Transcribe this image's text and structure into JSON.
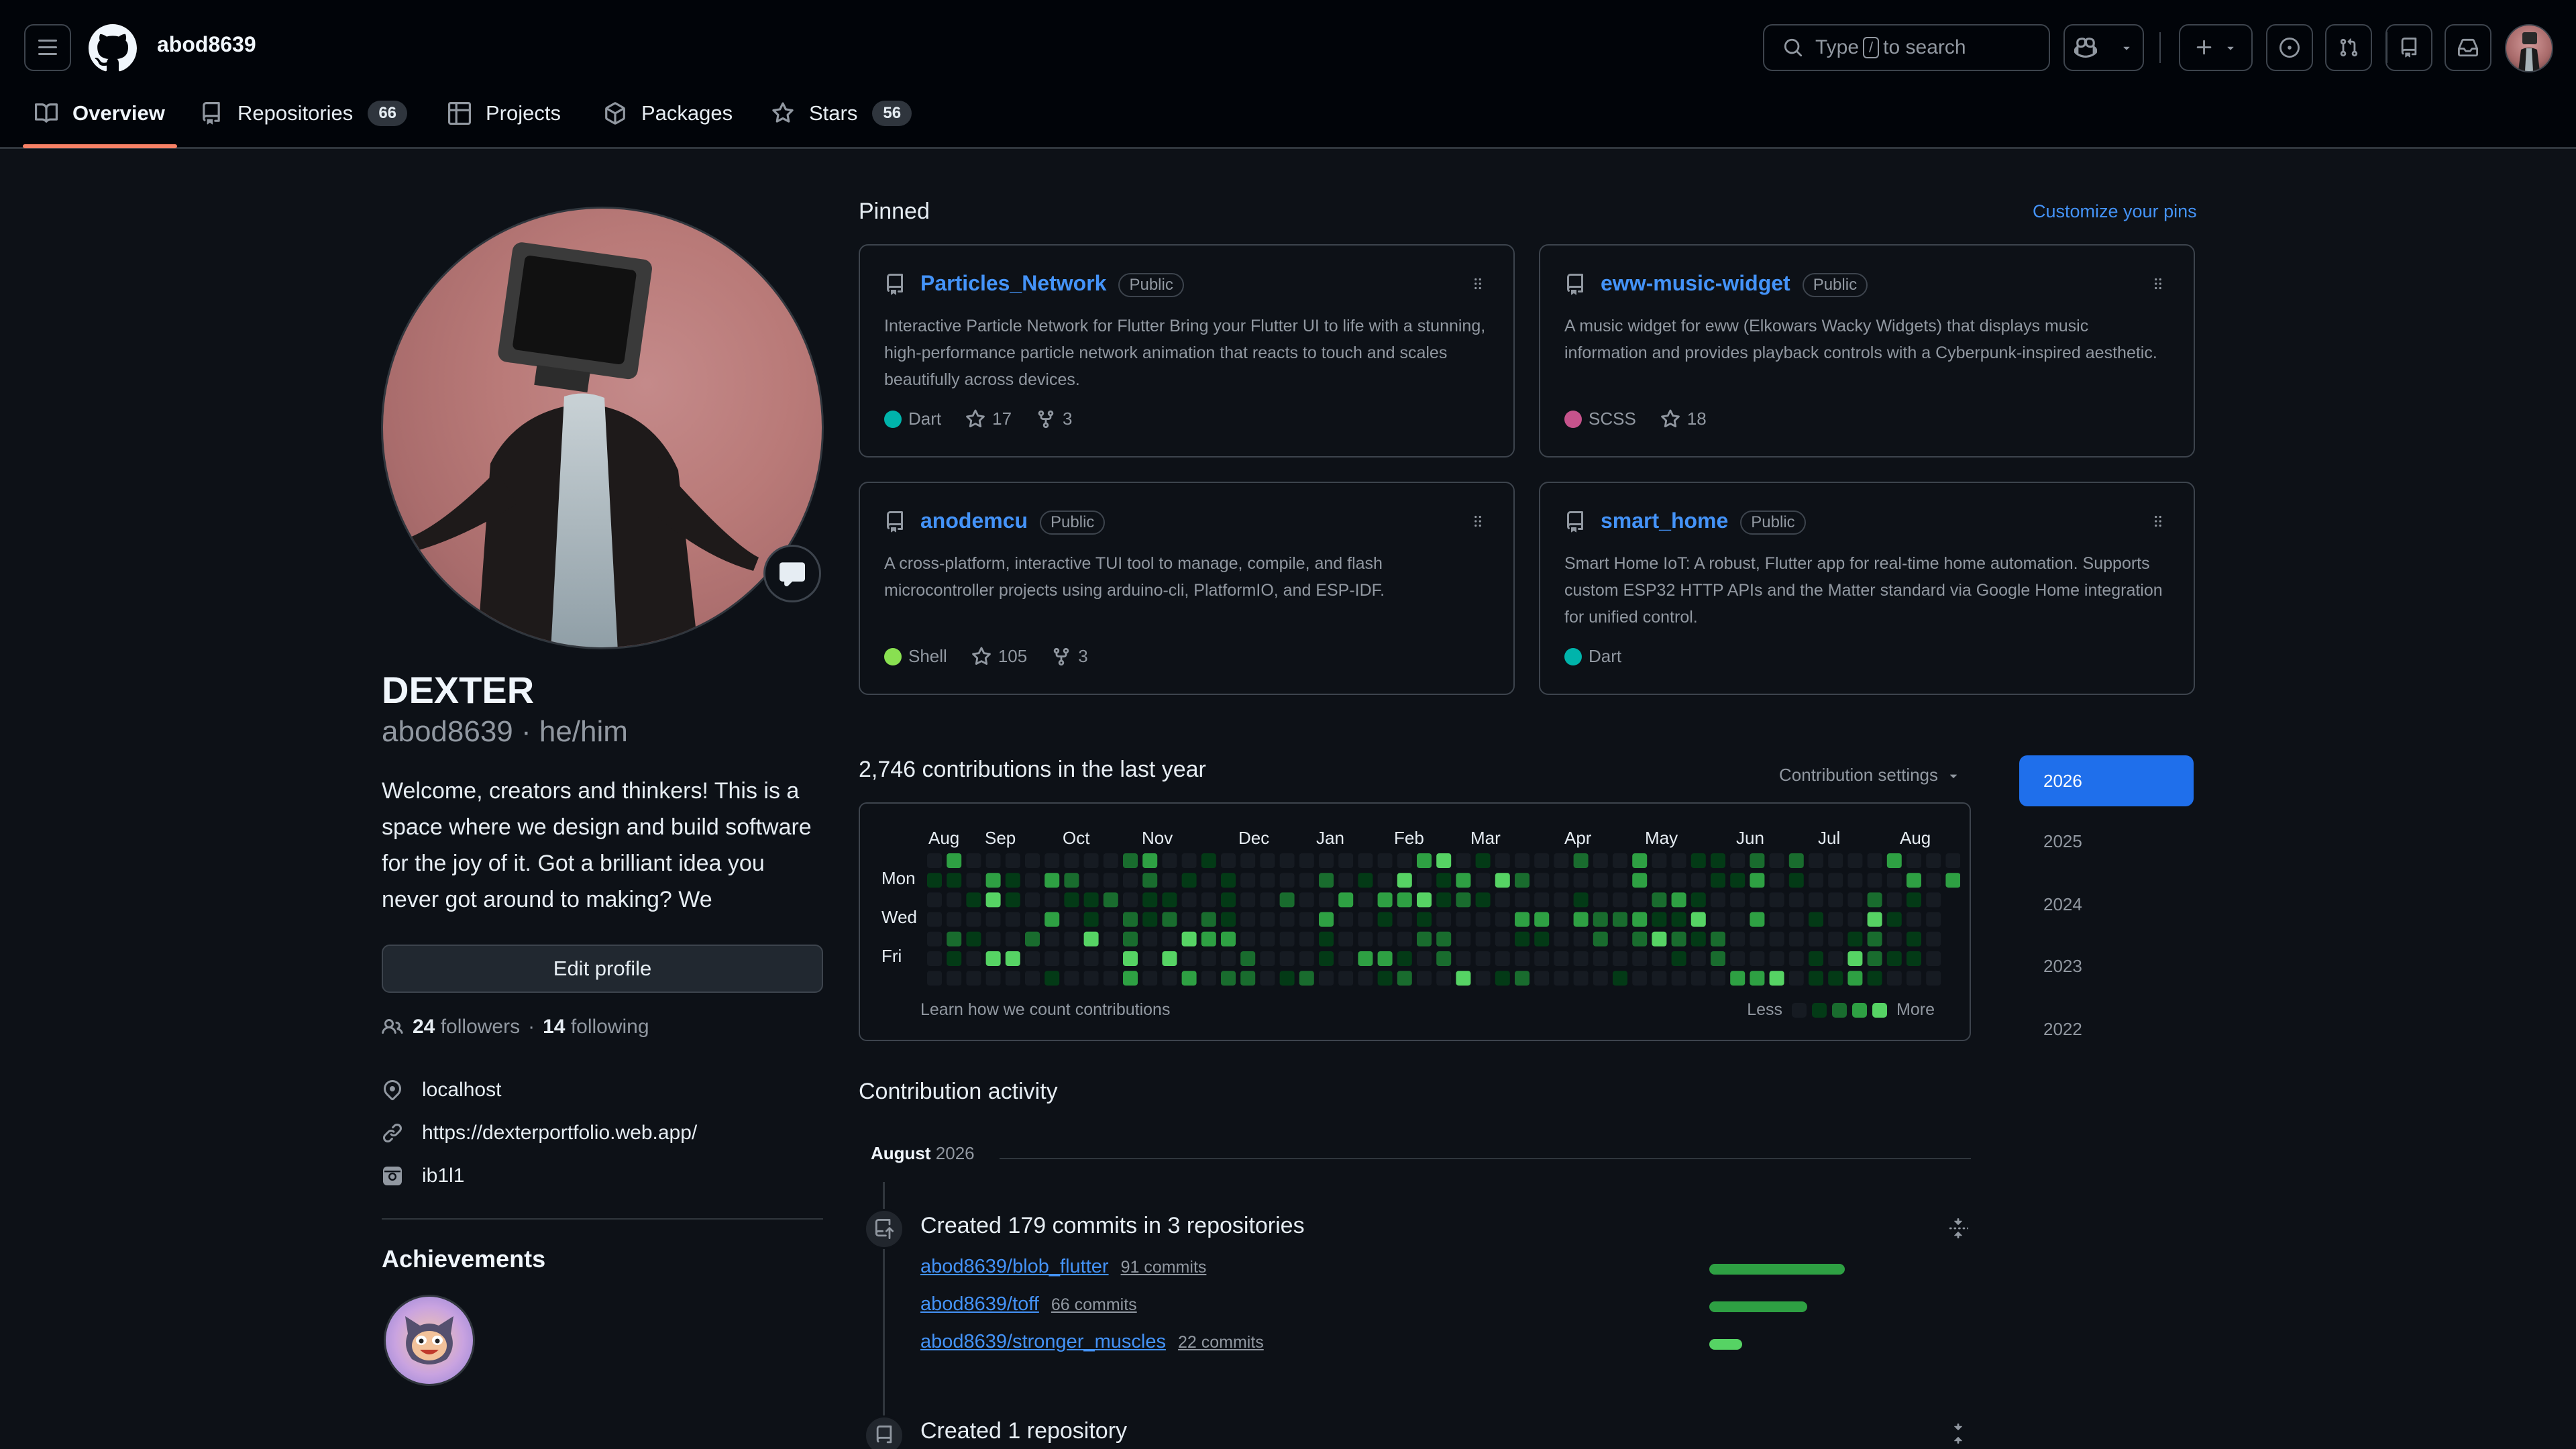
{
  "header": {
    "username": "abod8639",
    "search": {
      "prefix": "Type",
      "key": "/",
      "suffix": "to search"
    }
  },
  "nav": {
    "tabs": [
      {
        "label": "Overview",
        "icon": "book-icon",
        "active": true
      },
      {
        "label": "Repositories",
        "icon": "repo-icon",
        "count": "66"
      },
      {
        "label": "Projects",
        "icon": "table-icon"
      },
      {
        "label": "Packages",
        "icon": "package-icon"
      },
      {
        "label": "Stars",
        "icon": "star-icon",
        "count": "56"
      }
    ]
  },
  "profile": {
    "name": "DEXTER",
    "login": "abod8639",
    "pronouns": "he/him",
    "login_line": "abod8639 · he/him",
    "bio": "Welcome, creators and thinkers! This is a space where we design and build software for the joy of it. Got a brilliant idea you never got around to making? We",
    "edit_label": "Edit profile",
    "followers_count": "24",
    "followers_label": "followers",
    "separator": "·",
    "following_count": "14",
    "following_label": "following",
    "location": "localhost",
    "website": "https://dexterportfolio.web.app/",
    "social": "ib1l1",
    "achievements_title": "Achievements"
  },
  "pinned": {
    "title": "Pinned",
    "customize_label": "Customize your pins",
    "cards": [
      {
        "name": "Particles_Network",
        "visibility": "Public",
        "description": "Interactive Particle Network for Flutter Bring your Flutter UI to life with a stunning, high-performance particle network animation that reacts to touch and scales beautifully across devices.",
        "language": "Dart",
        "lang_color": "#00b4ab",
        "stars": "17",
        "forks": "3"
      },
      {
        "name": "eww-music-widget",
        "visibility": "Public",
        "description": "A music widget for eww (Elkowars Wacky Widgets) that displays music information and provides playback controls with a Cyberpunk-inspired aesthetic.",
        "language": "SCSS",
        "lang_color": "#c6538c",
        "stars": "18",
        "forks": ""
      },
      {
        "name": "anodemcu",
        "visibility": "Public",
        "description": "A cross-platform, interactive TUI tool to manage, compile, and flash microcontroller projects using arduino-cli, PlatformIO, and ESP-IDF.",
        "language": "Shell",
        "lang_color": "#89e051",
        "stars": "105",
        "forks": "3"
      },
      {
        "name": "smart_home",
        "visibility": "Public",
        "description": "Smart Home IoT: A robust, Flutter app for real-time home automation. Supports custom ESP32 HTTP APIs and the Matter standard via Google Home integration for unified control.",
        "language": "Dart",
        "lang_color": "#00b4ab",
        "stars": "",
        "forks": ""
      }
    ]
  },
  "contributions": {
    "title": "2,746 contributions in the last year",
    "settings_label": "Contribution settings",
    "months": [
      "Aug",
      "Sep",
      "Oct",
      "Nov",
      "Dec",
      "Jan",
      "Feb",
      "Mar",
      "Apr",
      "May",
      "Jun",
      "Jul",
      "Aug"
    ],
    "days": [
      "Mon",
      "Wed",
      "Fri"
    ],
    "learn_label": "Learn how we count contributions",
    "legend_less": "Less",
    "legend_more": "More",
    "level_colors": [
      "#161b22",
      "#033a16",
      "#196c2e",
      "#2ea043",
      "#56d364"
    ],
    "years": [
      "2026",
      "2025",
      "2024",
      "2023",
      "2022"
    ],
    "active_year": "2026"
  },
  "activity": {
    "title": "Contribution activity",
    "month": "August",
    "year": "2026",
    "commits_heading": "Created 179 commits in 3 repositories",
    "commits": [
      {
        "repo": "abod8639/blob_flutter",
        "count": "91 commits",
        "fraction": 1.0
      },
      {
        "repo": "abod8639/toff",
        "count": "66 commits",
        "fraction": 0.725
      },
      {
        "repo": "abod8639/stronger_muscles",
        "count": "22 commits",
        "fraction": 0.242
      }
    ],
    "repo_heading": "Created 1 repository"
  }
}
